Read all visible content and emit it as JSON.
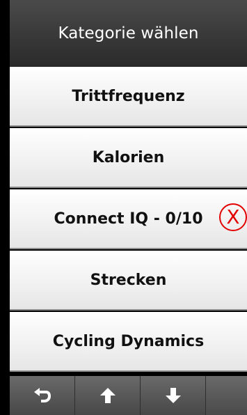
{
  "header": {
    "title": "Kategorie wählen"
  },
  "categories": [
    {
      "label": "Trittfrequenz"
    },
    {
      "label": "Kalorien"
    },
    {
      "label": "Connect IQ - 0/10",
      "marker": "X"
    },
    {
      "label": "Strecken"
    },
    {
      "label": "Cycling Dynamics"
    }
  ],
  "toolbar": {
    "buttons": [
      {
        "icon": "back-icon"
      },
      {
        "icon": "arrow-up-icon"
      },
      {
        "icon": "arrow-down-icon"
      }
    ]
  },
  "colors": {
    "marker": "#e30000",
    "title_bar": "#3a3a3a",
    "list_bg": "#f2f2f2"
  }
}
